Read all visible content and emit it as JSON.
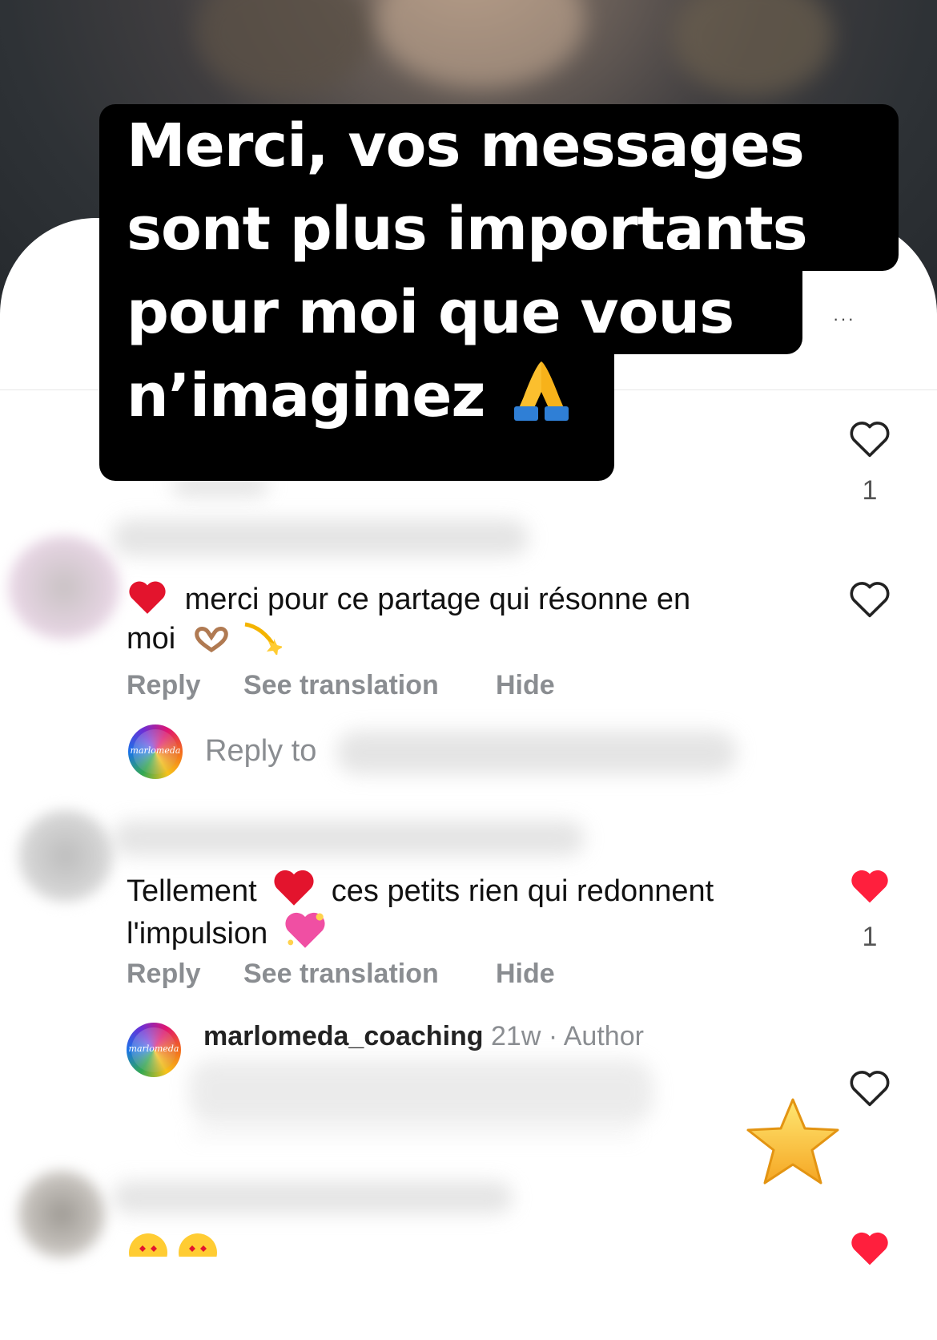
{
  "caption": {
    "line1": "Merci, vos messages",
    "line2": "sont plus importants",
    "line3": "pour moi que vous",
    "line4": "n’imaginez"
  },
  "top_comment": {
    "likes": "1"
  },
  "comments": [
    {
      "text_part1": "merci pour ce partage qui résonne en",
      "text_part2": "moi",
      "reply_label": "Reply",
      "translate_label": "See translation",
      "hide_label": "Hide",
      "liked": false,
      "likes": ""
    },
    {
      "text_part1": "Tellement",
      "text_part2": "ces petits rien qui redonnent",
      "text_part3": "l'impulsion",
      "reply_label": "Reply",
      "translate_label": "See translation",
      "hide_label": "Hide",
      "liked": true,
      "likes": "1"
    }
  ],
  "reply_box": {
    "placeholder": "Reply to"
  },
  "author_reply": {
    "username": "marlomeda_coaching",
    "time": "21w",
    "separator": "·",
    "badge": "Author",
    "avatar_text": "marlomeda"
  },
  "colors": {
    "like_red": "#ff1f3d",
    "action_gray": "#8a8d91",
    "caption_bg": "#000000"
  },
  "icons": [
    "heart-outline-icon",
    "heart-filled-icon",
    "praying-hands-emoji",
    "red-heart-emoji",
    "heart-hands-emoji",
    "dizzy-emoji",
    "sparkling-heart-emoji",
    "star-emoji",
    "heart-eyes-emoji"
  ]
}
